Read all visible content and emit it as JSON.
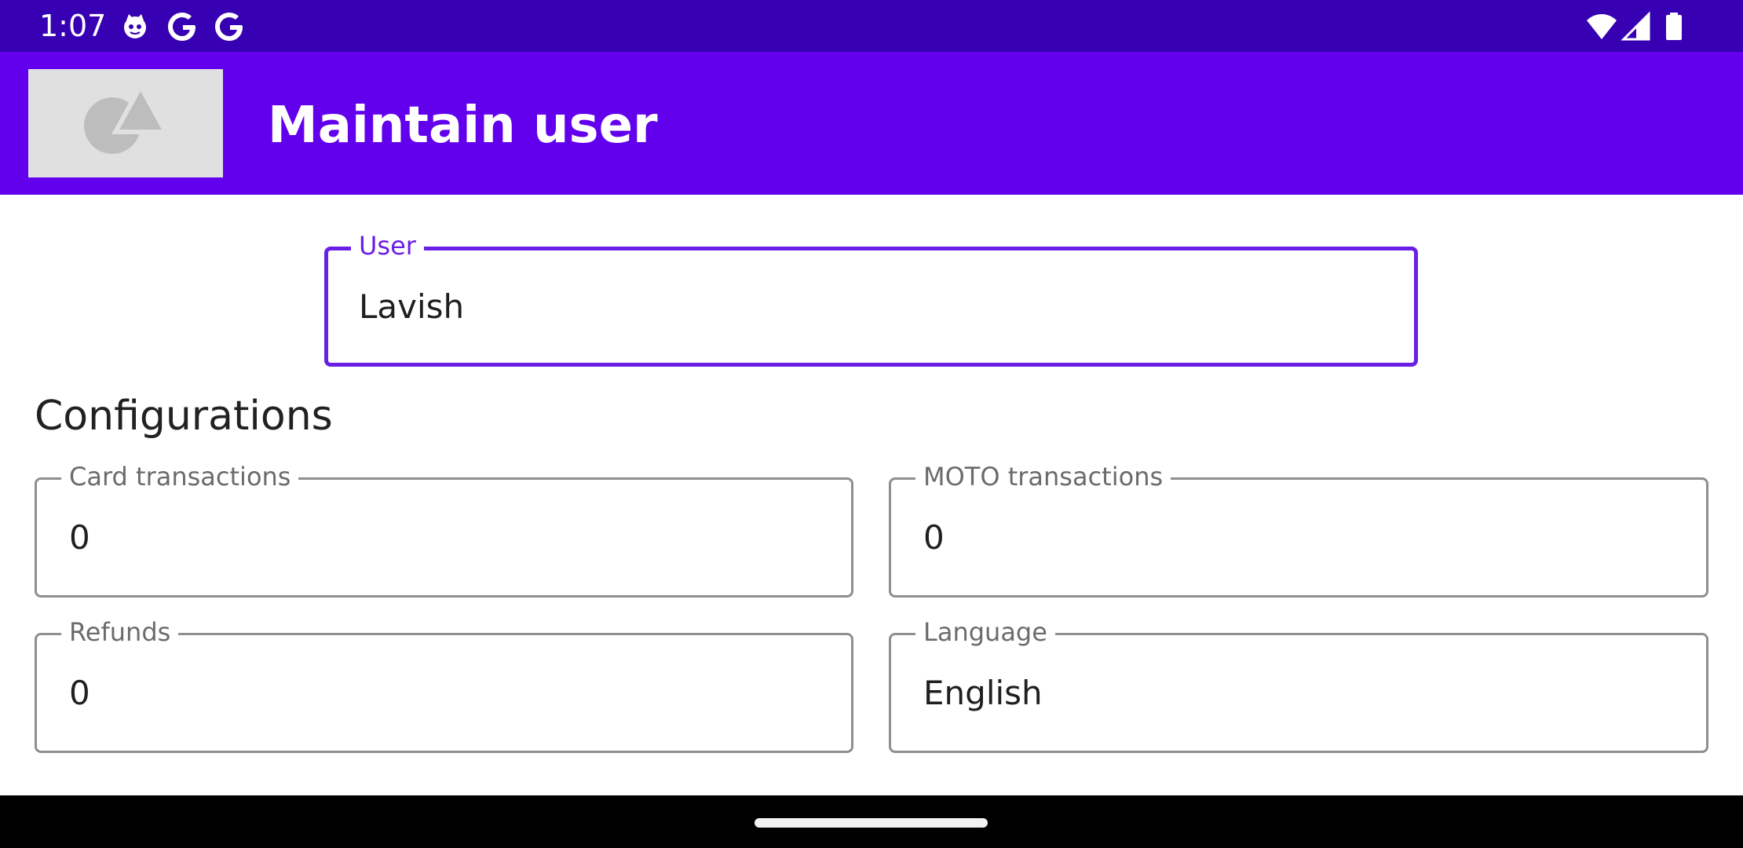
{
  "status_bar": {
    "time": "1:07",
    "icons_left": [
      "cat-notification-icon",
      "google-icon",
      "google-icon"
    ],
    "icons_right": [
      "wifi-icon",
      "cell-signal-icon",
      "battery-icon"
    ]
  },
  "app_bar": {
    "title": "Maintain user",
    "logo_icon": "image-placeholder-icon",
    "color": "#6200ee"
  },
  "user_field": {
    "label": "User",
    "value": "Lavish"
  },
  "configurations": {
    "title": "Configurations",
    "card_transactions": {
      "label": "Card transactions",
      "value": "0"
    },
    "moto_transactions": {
      "label": "MOTO transactions",
      "value": "0"
    },
    "refunds": {
      "label": "Refunds",
      "value": "0"
    },
    "language": {
      "label": "Language",
      "value": "English"
    }
  },
  "colors": {
    "status_bar": "#3700b3",
    "accent": "#6a1fe6",
    "outline": "#8f8f8f"
  }
}
